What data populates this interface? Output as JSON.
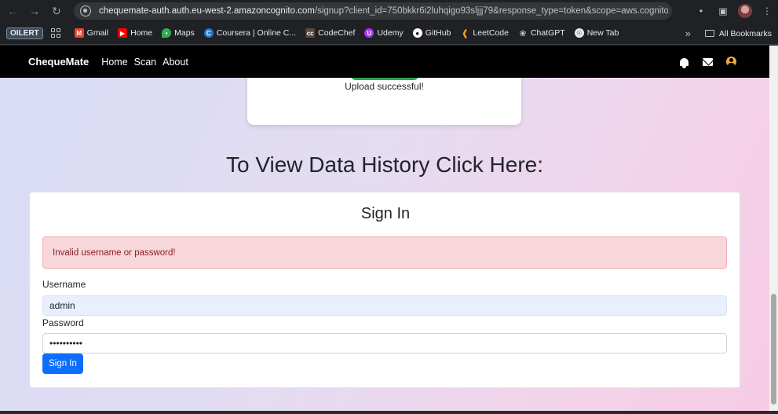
{
  "browser": {
    "url_host": "chequemate-auth.auth.eu-west-2.amazoncognito.com",
    "url_path": "/signup?client_id=750bkkr6i2luhqigo93sljjj79&response_type=token&scope=aws.cognito.sig..."
  },
  "bookmarks": {
    "oilert_label": "OILERT",
    "items": [
      "Gmail",
      "Home",
      "Maps",
      "Coursera | Online C...",
      "CodeChef",
      "Udemy",
      "GitHub",
      "LeetCode",
      "ChatGPT",
      "New Tab"
    ],
    "all_bookmarks_label": "All Bookmarks"
  },
  "app_nav": {
    "brand": "ChequeMate",
    "links": [
      "Home",
      "Scan",
      "About"
    ]
  },
  "upload": {
    "message": "Upload successful!"
  },
  "history": {
    "heading": "To View Data History Click Here:"
  },
  "signin": {
    "title": "Sign In",
    "error": "Invalid username or password!",
    "username_label": "Username",
    "username_value": "admin",
    "password_label": "Password",
    "password_value": "••••••••••",
    "submit_label": "Sign In"
  },
  "colors": {
    "primary_button": "#0d6efd",
    "alert_bg": "#f8d7da",
    "alert_text": "#842029",
    "nav_bg": "#000000",
    "upload_button": "#2ea44f"
  }
}
